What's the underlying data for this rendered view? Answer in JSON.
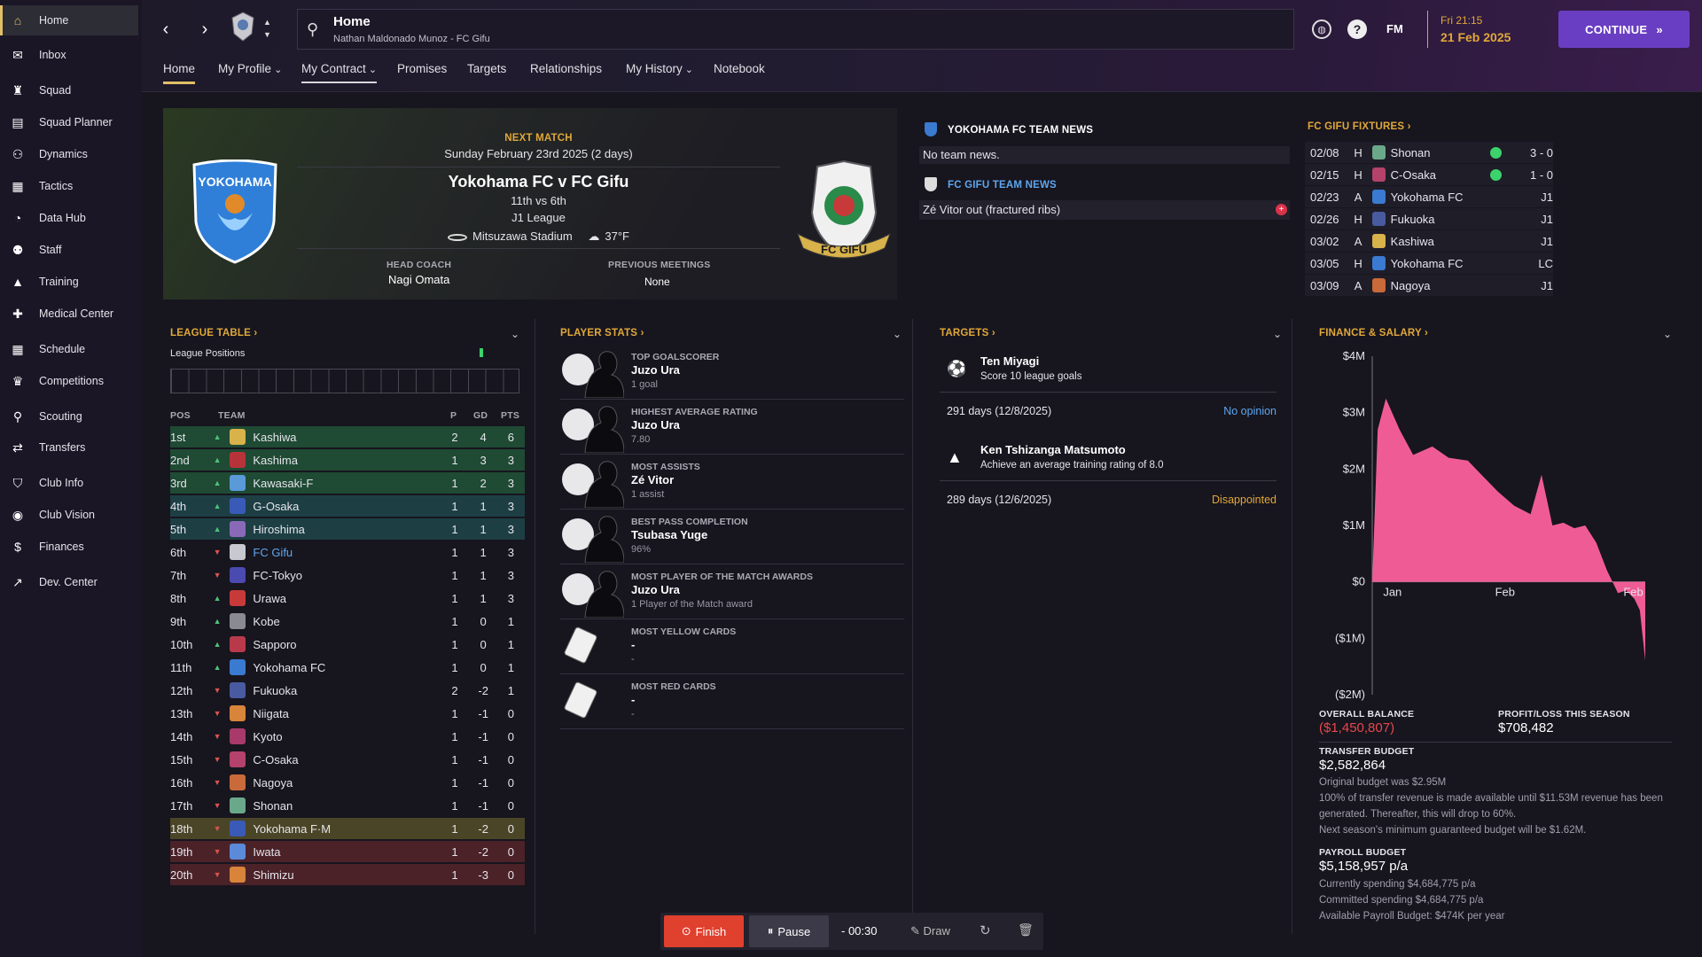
{
  "sidebar": {
    "items": [
      {
        "label": "Home",
        "icon": "home-icon",
        "glyph": "⌂"
      },
      {
        "label": "Inbox",
        "icon": "inbox-icon",
        "glyph": "✉"
      },
      {
        "label": "Squad",
        "icon": "squad-icon",
        "glyph": "♜"
      },
      {
        "label": "Squad Planner",
        "icon": "planner-icon",
        "glyph": "▤"
      },
      {
        "label": "Dynamics",
        "icon": "dynamics-icon",
        "glyph": "⚇"
      },
      {
        "label": "Tactics",
        "icon": "tactics-icon",
        "glyph": "▦"
      },
      {
        "label": "Data Hub",
        "icon": "data-hub-icon",
        "glyph": "◔"
      },
      {
        "label": "Staff",
        "icon": "staff-icon",
        "glyph": "⚉"
      },
      {
        "label": "Training",
        "icon": "training-icon",
        "glyph": "▲"
      },
      {
        "label": "Medical Center",
        "icon": "medical-icon",
        "glyph": "✚"
      },
      {
        "label": "Schedule",
        "icon": "schedule-icon",
        "glyph": "▦"
      },
      {
        "label": "Competitions",
        "icon": "trophy-icon",
        "glyph": "♛"
      },
      {
        "label": "Scouting",
        "icon": "scouting-icon",
        "glyph": "⚲"
      },
      {
        "label": "Transfers",
        "icon": "transfers-icon",
        "glyph": "⇄"
      },
      {
        "label": "Club Info",
        "icon": "shield-icon",
        "glyph": "⛉"
      },
      {
        "label": "Club Vision",
        "icon": "vision-icon",
        "glyph": "◉"
      },
      {
        "label": "Finances",
        "icon": "finances-icon",
        "glyph": "$"
      },
      {
        "label": "Dev. Center",
        "icon": "dev-center-icon",
        "glyph": "↗"
      }
    ]
  },
  "header": {
    "title": "Home",
    "subtitle": "Nathan Maldonado Munoz - FC Gifu",
    "fm": "FM",
    "date_line1": "Fri 21:15",
    "date_line2": "21 Feb 2025",
    "continue_label": "CONTINUE"
  },
  "tabs": [
    {
      "label": "Home",
      "dropdown": false
    },
    {
      "label": "My Profile",
      "dropdown": true
    },
    {
      "label": "My Contract",
      "dropdown": true
    },
    {
      "label": "Promises",
      "dropdown": false
    },
    {
      "label": "Targets",
      "dropdown": false
    },
    {
      "label": "Relationships",
      "dropdown": false
    },
    {
      "label": "My History",
      "dropdown": true
    },
    {
      "label": "Notebook",
      "dropdown": false
    }
  ],
  "next_match": {
    "label": "NEXT MATCH",
    "date": "Sunday February 23rd 2025 (2 days)",
    "title": "Yokohama FC v FC Gifu",
    "positions": "11th vs 6th",
    "competition": "J1 League",
    "stadium": "Mitsuzawa Stadium",
    "weather": "37°F",
    "head_coach_label": "HEAD COACH",
    "head_coach": "Nagi Omata",
    "prev_label": "PREVIOUS MEETINGS",
    "prev": "None",
    "home_crest_text": "YOKOHAMA",
    "away_crest_text": "FC GIFU"
  },
  "news": {
    "yokohama_label": "YOKOHAMA FC TEAM NEWS",
    "yokohama_text": "No team news.",
    "gifu_label": "FC GIFU TEAM NEWS",
    "gifu_text": "Zé Vitor out (fractured ribs)"
  },
  "fixtures": {
    "label": "FC GIFU FIXTURES",
    "rows": [
      {
        "date": "02/08",
        "ha": "H",
        "opp": "Shonan",
        "res": "3 - 0",
        "win": true,
        "color": "#6aa88a"
      },
      {
        "date": "02/15",
        "ha": "H",
        "opp": "C-Osaka",
        "res": "1 - 0",
        "win": true,
        "color": "#b5426a"
      },
      {
        "date": "02/23",
        "ha": "A",
        "opp": "Yokohama FC",
        "res": "J1",
        "win": false,
        "color": "#3a7ad0"
      },
      {
        "date": "02/26",
        "ha": "H",
        "opp": "Fukuoka",
        "res": "J1",
        "win": false,
        "color": "#4a5aa0"
      },
      {
        "date": "03/02",
        "ha": "A",
        "opp": "Kashiwa",
        "res": "J1",
        "win": false,
        "color": "#d8b24a"
      },
      {
        "date": "03/05",
        "ha": "H",
        "opp": "Yokohama FC",
        "res": "LC",
        "win": false,
        "color": "#3a7ad0"
      },
      {
        "date": "03/09",
        "ha": "A",
        "opp": "Nagoya",
        "res": "J1",
        "win": false,
        "color": "#c86a3a"
      }
    ]
  },
  "league": {
    "label": "LEAGUE TABLE",
    "positions_label": "League Positions",
    "headers": {
      "pos": "POS",
      "team": "TEAM",
      "p": "P",
      "gd": "GD",
      "pts": "PTS"
    },
    "rows": [
      {
        "pos": "1st",
        "dir": "up",
        "team": "Kashiwa",
        "p": "2",
        "gd": "4",
        "pts": "6",
        "zone": "green",
        "color": "#d8b24a"
      },
      {
        "pos": "2nd",
        "dir": "up",
        "team": "Kashima",
        "p": "1",
        "gd": "3",
        "pts": "3",
        "zone": "green",
        "color": "#b8323a"
      },
      {
        "pos": "3rd",
        "dir": "up",
        "team": "Kawasaki-F",
        "p": "1",
        "gd": "2",
        "pts": "3",
        "zone": "green",
        "color": "#5a9ad8"
      },
      {
        "pos": "4th",
        "dir": "up",
        "team": "G-Osaka",
        "p": "1",
        "gd": "1",
        "pts": "3",
        "zone": "teal",
        "color": "#3a5ab8"
      },
      {
        "pos": "5th",
        "dir": "up",
        "team": "Hiroshima",
        "p": "1",
        "gd": "1",
        "pts": "3",
        "zone": "teal",
        "color": "#8a6ab8"
      },
      {
        "pos": "6th",
        "dir": "down",
        "team": "FC Gifu",
        "p": "1",
        "gd": "1",
        "pts": "3",
        "zone": "none",
        "color": "#c8c8d0",
        "highlight": true
      },
      {
        "pos": "7th",
        "dir": "down",
        "team": "FC-Tokyo",
        "p": "1",
        "gd": "1",
        "pts": "3",
        "zone": "none",
        "color": "#4a4ab0"
      },
      {
        "pos": "8th",
        "dir": "up",
        "team": "Urawa",
        "p": "1",
        "gd": "1",
        "pts": "3",
        "zone": "none",
        "color": "#c83a3a"
      },
      {
        "pos": "9th",
        "dir": "up",
        "team": "Kobe",
        "p": "1",
        "gd": "0",
        "pts": "1",
        "zone": "none",
        "color": "#8a8a92"
      },
      {
        "pos": "10th",
        "dir": "up",
        "team": "Sapporo",
        "p": "1",
        "gd": "0",
        "pts": "1",
        "zone": "none",
        "color": "#b83a4a"
      },
      {
        "pos": "11th",
        "dir": "up",
        "team": "Yokohama FC",
        "p": "1",
        "gd": "0",
        "pts": "1",
        "zone": "none",
        "color": "#3a7ad0"
      },
      {
        "pos": "12th",
        "dir": "down",
        "team": "Fukuoka",
        "p": "2",
        "gd": "-2",
        "pts": "1",
        "zone": "none",
        "color": "#4a5aa0"
      },
      {
        "pos": "13th",
        "dir": "down",
        "team": "Niigata",
        "p": "1",
        "gd": "-1",
        "pts": "0",
        "zone": "none",
        "color": "#d8843a"
      },
      {
        "pos": "14th",
        "dir": "down",
        "team": "Kyoto",
        "p": "1",
        "gd": "-1",
        "pts": "0",
        "zone": "none",
        "color": "#a83a6a"
      },
      {
        "pos": "15th",
        "dir": "down",
        "team": "C-Osaka",
        "p": "1",
        "gd": "-1",
        "pts": "0",
        "zone": "none",
        "color": "#b5426a"
      },
      {
        "pos": "16th",
        "dir": "down",
        "team": "Nagoya",
        "p": "1",
        "gd": "-1",
        "pts": "0",
        "zone": "none",
        "color": "#c86a3a"
      },
      {
        "pos": "17th",
        "dir": "down",
        "team": "Shonan",
        "p": "1",
        "gd": "-1",
        "pts": "0",
        "zone": "none",
        "color": "#6aa88a"
      },
      {
        "pos": "18th",
        "dir": "down",
        "team": "Yokohama F·M",
        "p": "1",
        "gd": "-2",
        "pts": "0",
        "zone": "olive",
        "color": "#3a5ab8"
      },
      {
        "pos": "19th",
        "dir": "down",
        "team": "Iwata",
        "p": "1",
        "gd": "-2",
        "pts": "0",
        "zone": "red",
        "color": "#5a8ad8"
      },
      {
        "pos": "20th",
        "dir": "down",
        "team": "Shimizu",
        "p": "1",
        "gd": "-3",
        "pts": "0",
        "zone": "red",
        "color": "#d8843a"
      }
    ]
  },
  "player_stats": {
    "label": "PLAYER STATS",
    "items": [
      {
        "title": "TOP GOALSCORER",
        "name": "Juzo Ura",
        "sub": "1 goal",
        "icon": "football-icon"
      },
      {
        "title": "HIGHEST AVERAGE RATING",
        "name": "Juzo Ura",
        "sub": "7.80",
        "icon": "rating-badge-icon"
      },
      {
        "title": "MOST ASSISTS",
        "name": "Zé Vitor",
        "sub": "1 assist",
        "icon": "assist-icon"
      },
      {
        "title": "BEST PASS COMPLETION",
        "name": "Tsubasa Yuge",
        "sub": "96%",
        "icon": "percent-icon"
      },
      {
        "title": "MOST PLAYER OF THE MATCH AWARDS",
        "name": "Juzo Ura",
        "sub": "1 Player of the Match award",
        "icon": "star-icon"
      },
      {
        "title": "MOST YELLOW CARDS",
        "name": "-",
        "sub": "-",
        "icon": "yellow-card-icon"
      },
      {
        "title": "MOST RED CARDS",
        "name": "-",
        "sub": "-",
        "icon": "red-card-icon"
      }
    ]
  },
  "targets": {
    "label": "TARGETS",
    "items": [
      {
        "name": "Ten Miyagi",
        "desc": "Score 10 league goals",
        "days": "291 days (12/8/2025)",
        "status": "No opinion",
        "status_color": "#5ea7ef",
        "icon": "football-icon"
      },
      {
        "name": "Ken Tshizanga Matsumoto",
        "desc": "Achieve an average training rating of 8.0",
        "days": "289 days (12/6/2025)",
        "status": "Disappointed",
        "status_color": "#e0a83a",
        "icon": "training-icon"
      }
    ]
  },
  "finance": {
    "label": "FINANCE & SALARY",
    "overall_label": "OVERALL BALANCE",
    "overall_value": "($1,450,807)",
    "profit_label": "PROFIT/LOSS THIS SEASON",
    "profit_value": "$708,482",
    "transfer_label": "TRANSFER BUDGET",
    "transfer_value": "$2,582,864",
    "transfer_notes": [
      "Original budget was $2.95M",
      "100% of transfer revenue is made available until $11.53M revenue has been generated. Thereafter, this will drop to 60%.",
      "Next season's minimum guaranteed budget will be $1.62M."
    ],
    "payroll_label": "PAYROLL BUDGET",
    "payroll_value": "$5,158,957 p/a",
    "payroll_notes": [
      "Currently spending $4,684,775 p/a",
      "Committed spending $4,684,775 p/a",
      "Available Payroll Budget: $474K per year"
    ]
  },
  "chart_data": {
    "type": "area",
    "y_ticks": [
      "$4M",
      "$3M",
      "$2M",
      "$1M",
      "$0",
      "($1M)",
      "($2M)"
    ],
    "x_ticks": [
      "Jan",
      "Feb",
      "Feb"
    ],
    "ylim": [
      -2000000,
      4000000
    ],
    "x": [
      0,
      0.02,
      0.05,
      0.1,
      0.15,
      0.22,
      0.28,
      0.35,
      0.4,
      0.46,
      0.52,
      0.58,
      0.62,
      0.66,
      0.7,
      0.74,
      0.78,
      0.82,
      0.86,
      0.9,
      0.93,
      0.96,
      0.98,
      1.0
    ],
    "values": [
      0,
      2700000,
      3250000,
      2700000,
      2250000,
      2400000,
      2200000,
      2150000,
      1900000,
      1600000,
      1350000,
      1200000,
      1900000,
      1000000,
      1050000,
      950000,
      1000000,
      700000,
      200000,
      -200000,
      -150000,
      -300000,
      -500000,
      -1400000
    ],
    "color": "#ef5c95"
  },
  "controls": {
    "finish": "Finish",
    "pause": "Pause",
    "time": "- 00:30",
    "draw": "Draw"
  }
}
